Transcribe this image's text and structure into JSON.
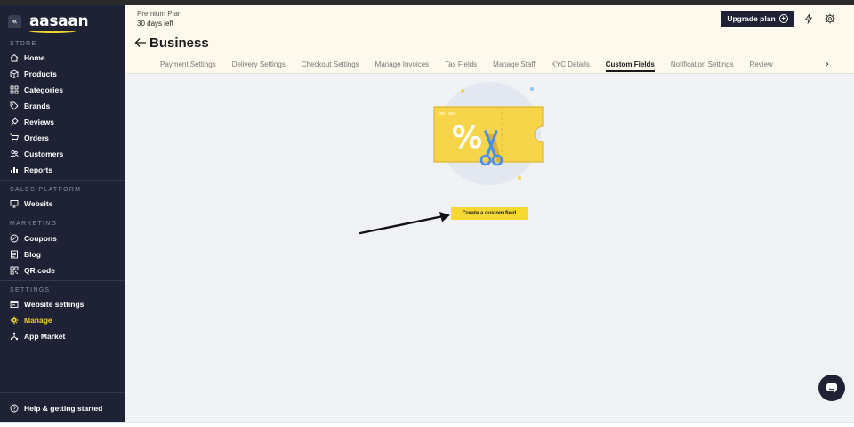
{
  "brand": {
    "logo_text": "aasaan",
    "collapse_icon": "«"
  },
  "sidebar": {
    "sections": [
      {
        "label": "STORE"
      },
      {
        "label": "SALES PLATFORM"
      },
      {
        "label": "MARKETING"
      },
      {
        "label": "SETTINGS"
      }
    ],
    "store_items": [
      {
        "label": "Home",
        "icon": "home-icon"
      },
      {
        "label": "Products",
        "icon": "box-icon"
      },
      {
        "label": "Categories",
        "icon": "grid-icon"
      },
      {
        "label": "Brands",
        "icon": "tag-icon"
      },
      {
        "label": "Reviews",
        "icon": "thumbs-icon"
      },
      {
        "label": "Orders",
        "icon": "cart-icon"
      },
      {
        "label": "Customers",
        "icon": "users-icon"
      },
      {
        "label": "Reports",
        "icon": "bar-chart-icon"
      }
    ],
    "sales_items": [
      {
        "label": "Website",
        "icon": "monitor-icon"
      }
    ],
    "marketing_items": [
      {
        "label": "Coupons",
        "icon": "percent-icon"
      },
      {
        "label": "Blog",
        "icon": "document-icon"
      },
      {
        "label": "QR code",
        "icon": "qr-icon"
      }
    ],
    "settings_items": [
      {
        "label": "Website settings",
        "icon": "browser-icon"
      },
      {
        "label": "Manage",
        "icon": "gear-icon",
        "active": true
      },
      {
        "label": "App Market",
        "icon": "nodes-icon"
      }
    ],
    "help": {
      "label": "Help & getting started",
      "icon": "help-icon"
    },
    "active_color": "#f2d22e"
  },
  "header": {
    "plan_name": "Premium Plan",
    "plan_days": "30 days left",
    "upgrade_label": "Upgrade plan",
    "page_title": "Business",
    "tabs": [
      "Payment Settings",
      "Delivery Settings",
      "Checkout Settings",
      "Manage Invoices",
      "Tax Fields",
      "Manage Staff",
      "KYC Details",
      "Custom Fields",
      "Notification Settings",
      "Review"
    ],
    "active_tab": "Custom Fields"
  },
  "content": {
    "create_button_label": "Create a custom field",
    "accent_color": "#f5d833"
  }
}
